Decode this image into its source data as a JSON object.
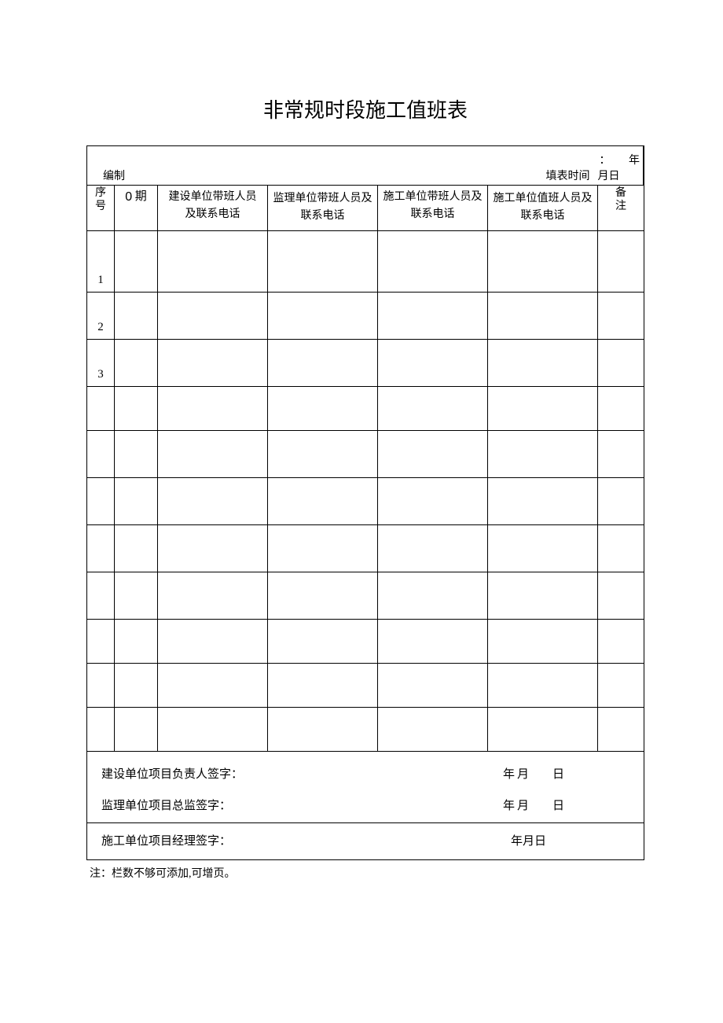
{
  "title": "非常规时段施工值班表",
  "meta": {
    "compile_label": "编制",
    "fill_time_label": "填表时间",
    "colon": "：",
    "date_placeholder": "年月日"
  },
  "headers": {
    "seq": "序号",
    "seq_l1": "序",
    "seq_l2": "号",
    "date_zero": "0",
    "date_period": "期",
    "construction_unit": "建设单位带班人员及联系电话",
    "cu_l1": "建设单位带班人员",
    "cu_l2": "及联系电话",
    "supervision_unit": "监理单位带班人员及联系电话",
    "su_l1": "监理单位带班人员及",
    "su_l2": "联系电话",
    "contractor_lead": "施工单位带班人员及联系电话",
    "cl_l1": "施工单位带班人员及",
    "cl_l2": "联系电话",
    "contractor_duty": "施工单位值班人员及联系电话",
    "cd_l1": "施工单位值班人员及",
    "cd_l2": "联系电话",
    "note": "备注",
    "note_l1": "备",
    "note_l2": "注"
  },
  "rows": [
    {
      "seq": "1"
    },
    {
      "seq": "2"
    },
    {
      "seq": "3"
    },
    {
      "seq": ""
    },
    {
      "seq": ""
    },
    {
      "seq": ""
    },
    {
      "seq": ""
    },
    {
      "seq": ""
    },
    {
      "seq": ""
    },
    {
      "seq": ""
    },
    {
      "seq": ""
    }
  ],
  "signatures": {
    "construction_owner": "建设单位项目负责人签字：",
    "supervision_chief": "监理单位项目总监签字：",
    "project_manager": "施工单位项目经理签字：",
    "date_ym": "年月",
    "date_d": "日",
    "date_ymd": "年月日"
  },
  "footnote": "注：栏数不够可添加,可增页。"
}
